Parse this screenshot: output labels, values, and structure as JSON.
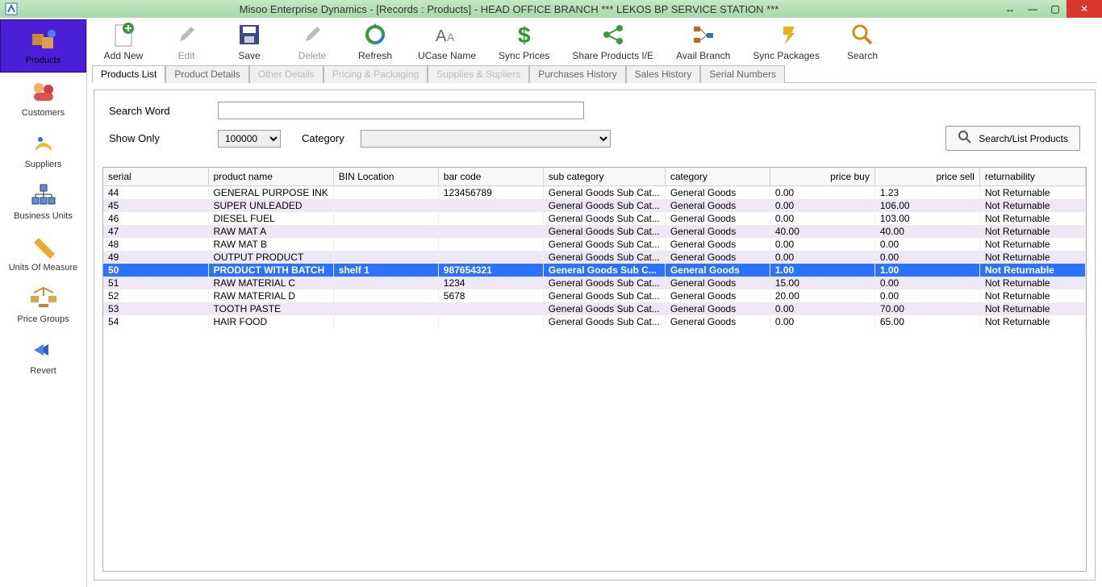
{
  "window": {
    "title": "Misoo Enterprise Dynamics - [Records : Products] - HEAD OFFICE BRANCH *** LEKOS BP SERVICE STATION ***"
  },
  "toolbar": {
    "add_new": "Add New",
    "edit": "Edit",
    "save": "Save",
    "delete": "Delete",
    "refresh": "Refresh",
    "ucase_name": "UCase  Name",
    "sync_prices": "Sync Prices",
    "share_products": "Share Products I/E",
    "avail_branch": "Avail Branch",
    "sync_packages": "Sync Packages",
    "search": "Search"
  },
  "sidebar": {
    "products": "Products",
    "customers": "Customers",
    "suppliers": "Suppliers",
    "business_units": "Business Units",
    "uom": "Units Of Measure",
    "price_groups": "Price Groups",
    "revert": "Revert"
  },
  "tabs": {
    "products_list": "Products List",
    "product_details": "Product Details",
    "other_details": "Other Details",
    "pricing_packaging": "Pricing & Packaging",
    "supplies_suppliers": "Supplies & Supliers",
    "purchases_history": "Purchases History",
    "sales_history": "Sales History",
    "serial_numbers": "Serial Numbers"
  },
  "search_panel": {
    "search_word_label": "Search Word",
    "show_only_label": "Show Only",
    "show_only_value": "100000",
    "category_label": "Category",
    "search_list_button": "Search/List Products"
  },
  "grid": {
    "columns": {
      "serial": "serial",
      "product_name": "product name",
      "bin_location": "BIN Location",
      "bar_code": "bar code",
      "sub_category": "sub category",
      "category": "category",
      "price_buy": "price buy",
      "price_sell": "price sell",
      "returnability": "returnability"
    },
    "rows": [
      {
        "serial": "44",
        "name": "GENERAL PURPOSE INK",
        "bin": "",
        "barcode": "123456789",
        "subcat": "General Goods Sub Cat...",
        "cat": "General Goods",
        "pbuy": "0.00",
        "psell": "1.23",
        "ret": "Not Returnable",
        "selected": false
      },
      {
        "serial": "45",
        "name": "SUPER UNLEADED",
        "bin": "",
        "barcode": "",
        "subcat": "General Goods Sub Cat...",
        "cat": "General Goods",
        "pbuy": "0.00",
        "psell": "106.00",
        "ret": "Not Returnable",
        "selected": false
      },
      {
        "serial": "46",
        "name": "DIESEL FUEL",
        "bin": "",
        "barcode": "",
        "subcat": "General Goods Sub Cat...",
        "cat": "General Goods",
        "pbuy": "0.00",
        "psell": "103.00",
        "ret": "Not Returnable",
        "selected": false
      },
      {
        "serial": "47",
        "name": "RAW MAT A",
        "bin": "",
        "barcode": "",
        "subcat": "General Goods Sub Cat...",
        "cat": "General Goods",
        "pbuy": "40.00",
        "psell": "40.00",
        "ret": "Not Returnable",
        "selected": false
      },
      {
        "serial": "48",
        "name": "RAW MAT B",
        "bin": "",
        "barcode": "",
        "subcat": "General Goods Sub Cat...",
        "cat": "General Goods",
        "pbuy": "0.00",
        "psell": "0.00",
        "ret": "Not Returnable",
        "selected": false
      },
      {
        "serial": "49",
        "name": "OUTPUT PRODUCT",
        "bin": "",
        "barcode": "",
        "subcat": "General Goods Sub Cat...",
        "cat": "General Goods",
        "pbuy": "0.00",
        "psell": "0.00",
        "ret": "Not Returnable",
        "selected": false
      },
      {
        "serial": "50",
        "name": "PRODUCT WITH BATCH",
        "bin": "shelf 1",
        "barcode": "987654321",
        "subcat": "General Goods Sub C...",
        "cat": "General Goods",
        "pbuy": "1.00",
        "psell": "1.00",
        "ret": "Not Returnable",
        "selected": true
      },
      {
        "serial": "51",
        "name": "RAW MATERIAL C",
        "bin": "",
        "barcode": "1234",
        "subcat": "General Goods Sub Cat...",
        "cat": "General Goods",
        "pbuy": "15.00",
        "psell": "0.00",
        "ret": "Not Returnable",
        "selected": false
      },
      {
        "serial": "52",
        "name": "RAW MATERIAL D",
        "bin": "",
        "barcode": "5678",
        "subcat": "General Goods Sub Cat...",
        "cat": "General Goods",
        "pbuy": "20.00",
        "psell": "0.00",
        "ret": "Not Returnable",
        "selected": false
      },
      {
        "serial": "53",
        "name": "TOOTH PASTE",
        "bin": "",
        "barcode": "",
        "subcat": "General Goods Sub Cat...",
        "cat": "General Goods",
        "pbuy": "0.00",
        "psell": "70.00",
        "ret": "Not Returnable",
        "selected": false
      },
      {
        "serial": "54",
        "name": "HAIR FOOD",
        "bin": "",
        "barcode": "",
        "subcat": "General Goods Sub Cat...",
        "cat": "General Goods",
        "pbuy": "0.00",
        "psell": "65.00",
        "ret": "Not Returnable",
        "selected": false
      }
    ]
  }
}
